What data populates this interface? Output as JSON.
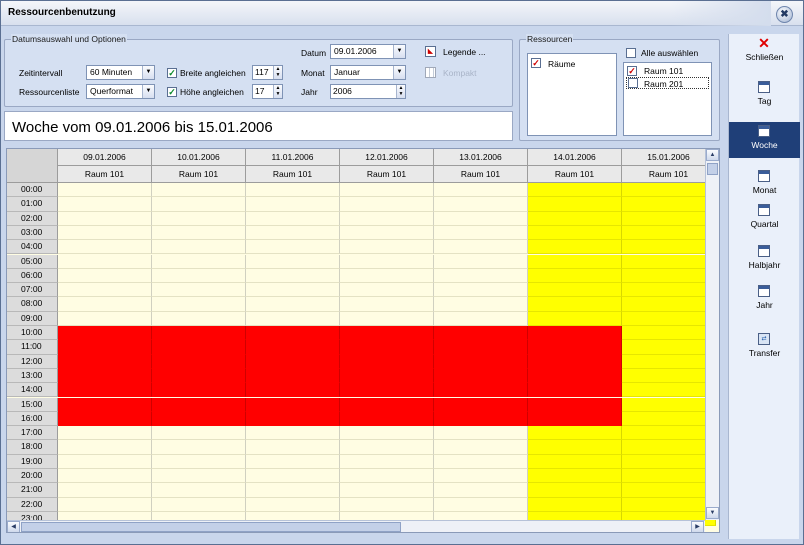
{
  "window": {
    "title": "Ressourcenbenutzung",
    "close_symbol": "✖"
  },
  "options": {
    "group_label": "Datumsauswahl und Optionen",
    "zeitintervall_label": "Zeitintervall",
    "zeitintervall_value": "60 Minuten",
    "ressourcenliste_label": "Ressourcenliste",
    "ressourcenliste_value": "Querformat",
    "breite_label": "Breite angleichen",
    "breite_checked": true,
    "breite_value": "117",
    "hoehe_label": "Höhe angleichen",
    "hoehe_checked": true,
    "hoehe_value": "17",
    "datum_label": "Datum",
    "datum_value": "09.01.2006",
    "monat_label": "Monat",
    "monat_value": "Januar",
    "jahr_label": "Jahr",
    "jahr_value": "2006",
    "legende_label": "Legende ...",
    "kompakt_label": "Kompakt"
  },
  "week_title": "Woche vom 09.01.2006 bis 15.01.2006",
  "resources": {
    "group_label": "Ressourcen",
    "category": "Räume",
    "category_checked": true,
    "select_all_label": "Alle auswählen",
    "select_all_checked": false,
    "items": [
      {
        "label": "Raum 101",
        "checked": true
      },
      {
        "label": "Raum 201",
        "checked": false
      }
    ]
  },
  "grid": {
    "days": [
      "09.01.2006",
      "10.01.2006",
      "11.01.2006",
      "12.01.2006",
      "13.01.2006",
      "14.01.2006",
      "15.01.2006"
    ],
    "room": "Raum 101",
    "hours": [
      "00:00",
      "01:00",
      "02:00",
      "03:00",
      "04:00",
      "05:00",
      "06:00",
      "07:00",
      "08:00",
      "09:00",
      "10:00",
      "11:00",
      "12:00",
      "13:00",
      "14:00",
      "15:00",
      "16:00",
      "17:00",
      "18:00",
      "19:00",
      "20:00",
      "21:00",
      "22:00",
      "23:00"
    ],
    "colors": {
      "free": "#fffde3",
      "weekend": "#ffff00",
      "booked": "#ff0000"
    },
    "booked_days": [
      0,
      1,
      2,
      3,
      4,
      5
    ],
    "booked_hours": [
      "10:00",
      "16:00"
    ],
    "weekend_days": [
      5,
      6
    ]
  },
  "nav": {
    "items": [
      {
        "label": "Schließen",
        "icon": "close-icon"
      },
      {
        "label": "Tag",
        "icon": "day-calendar-icon"
      },
      {
        "label": "Woche",
        "icon": "week-calendar-icon",
        "active": true
      },
      {
        "label": "Monat",
        "icon": "month-calendar-icon"
      },
      {
        "label": "Quartal",
        "icon": "quarter-calendar-icon"
      },
      {
        "label": "Halbjahr",
        "icon": "halfyear-calendar-icon"
      },
      {
        "label": "Jahr",
        "icon": "year-calendar-icon"
      },
      {
        "label": "Transfer",
        "icon": "transfer-icon"
      }
    ]
  }
}
